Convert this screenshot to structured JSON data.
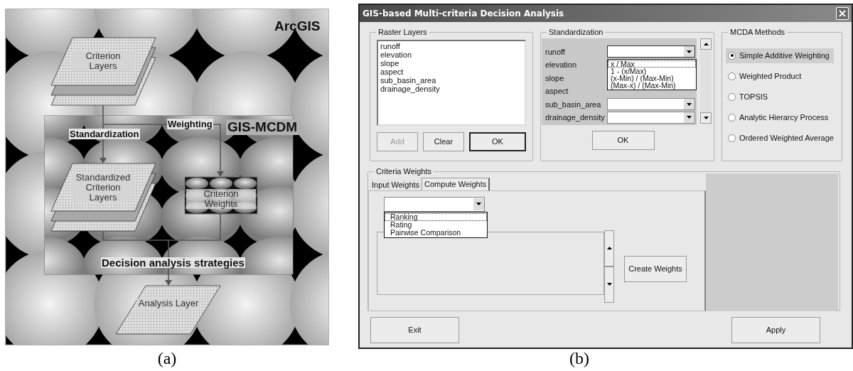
{
  "figure_a": {
    "container_label": "ArcGIS",
    "inner_label": "GIS-MCDM",
    "nodes": [
      {
        "kind": "stack",
        "label": "Criterion Layers"
      },
      {
        "kind": "stack",
        "label": "Standardized Criterion Layers"
      },
      {
        "kind": "weights",
        "label": "Criterion Weights"
      },
      {
        "kind": "layer",
        "label": "Analysis Layer"
      }
    ],
    "edge_labels": [
      "Standardization",
      "Weighting",
      "Decision analysis strategies"
    ],
    "caption": "(a)"
  },
  "figure_b": {
    "window": {
      "title": "GIS-based Multi-criteria Decision Analysis"
    },
    "raster_layers": {
      "legend": "Raster Layers",
      "items": [
        "runoff",
        "elevation",
        "slope",
        "aspect",
        "sub_basin_area",
        "drainage_density"
      ],
      "buttons": [
        {
          "label": "Add",
          "disabled": true,
          "default": false
        },
        {
          "label": "Clear",
          "disabled": false,
          "default": false
        },
        {
          "label": "OK",
          "disabled": false,
          "default": true
        }
      ]
    },
    "standardization": {
      "legend": "Standardization",
      "rows": [
        {
          "label": "runoff",
          "kind": "combo",
          "open": true
        },
        {
          "label": "elevation",
          "kind": "covered",
          "open": false
        },
        {
          "label": "slope",
          "kind": "covered",
          "open": false
        },
        {
          "label": "aspect",
          "kind": "covered",
          "open": false
        },
        {
          "label": "sub_basin_area",
          "kind": "combo",
          "open": false
        },
        {
          "label": "drainage_density",
          "kind": "combo",
          "open": false
        }
      ],
      "options": [
        {
          "label": "x / Max",
          "focused": true
        },
        {
          "label": "1 - (x/Max)",
          "focused": false
        },
        {
          "label": "(x-Min) / (Max-Min)",
          "focused": false
        },
        {
          "label": "(Max-x) / (Max-Min)",
          "focused": false
        }
      ],
      "button": "OK"
    },
    "mcda_methods": {
      "legend": "MCDA Methods",
      "options": [
        {
          "label": "Simple Additive Weighting",
          "selected": true
        },
        {
          "label": "Weighted Product",
          "selected": false
        },
        {
          "label": "TOPSIS",
          "selected": false
        },
        {
          "label": "Analytic Hierarcy Process",
          "selected": false
        },
        {
          "label": "Ordered Weighted Average",
          "selected": false
        }
      ]
    },
    "criteria_weights": {
      "legend": "Criteria Weights",
      "tabs": [
        {
          "label": "Input Weights",
          "selected": false
        },
        {
          "label": "Compute Weights",
          "selected": true
        }
      ],
      "method_options": [
        {
          "label": "Ranking",
          "focused": true
        },
        {
          "label": "Rating",
          "focused": false
        },
        {
          "label": "Pairwise Comparison",
          "focused": false
        }
      ],
      "button": "Create Weights"
    },
    "buttons": [
      "Exit",
      "Apply"
    ],
    "caption": "(b)"
  }
}
